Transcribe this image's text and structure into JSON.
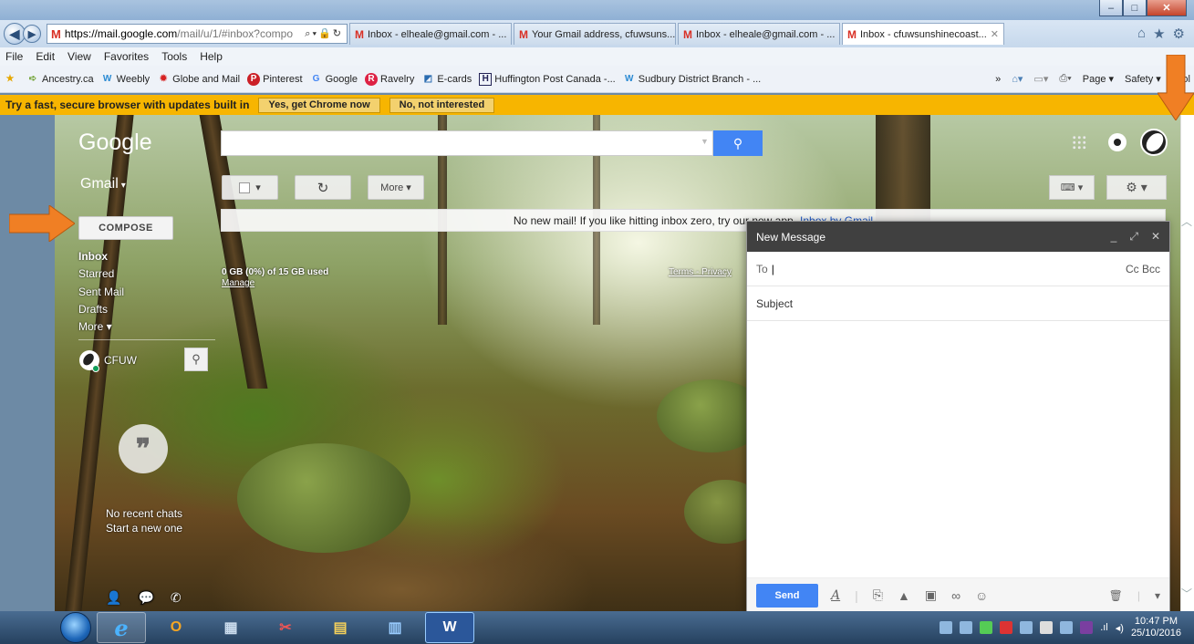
{
  "browser": {
    "url_host": "https://mail.google.com",
    "url_path": "/mail/u/1/#inbox?compo",
    "tabs": [
      {
        "label": "Inbox - elheale@gmail.com - ..."
      },
      {
        "label": "Your Gmail address, cfuwsuns..."
      },
      {
        "label": "Inbox - elheale@gmail.com - ..."
      },
      {
        "label": "Inbox - cfuwsunshinecoast..."
      }
    ],
    "menu": [
      "File",
      "Edit",
      "View",
      "Favorites",
      "Tools",
      "Help"
    ],
    "favorites": [
      "Ancestry.ca",
      "Weebly",
      "Globe and Mail",
      "Pinterest",
      "Google",
      "Ravelry",
      "E-cards",
      "Huffington Post Canada -...",
      "Sudbury District Branch - ..."
    ],
    "command_bar": [
      "Page ▾",
      "Safety ▾",
      "Tool"
    ],
    "chrome_prompt": "Try a fast, secure browser with updates built in",
    "chrome_yes": "Yes, get Chrome now",
    "chrome_no": "No, not interested"
  },
  "gmail": {
    "logo": "Google",
    "product": "Gmail",
    "compose": "COMPOSE",
    "more_btn": "More ▾",
    "notice_text": "No new mail! If you like hitting inbox zero, try our new app,",
    "notice_link": "Inbox by Gmail",
    "nav": {
      "inbox": "Inbox",
      "starred": "Starred",
      "sent": "Sent Mail",
      "drafts": "Drafts",
      "more": "More ▾"
    },
    "storage": "0 GB (0%) of 15 GB used",
    "manage": "Manage",
    "terms": "Terms - Privacy",
    "hangouts_name": "CFUW",
    "no_chats": "No recent chats",
    "start_new": "Start a new one"
  },
  "compose_window": {
    "title": "New Message",
    "to_label": "To",
    "cc_bcc": "Cc Bcc",
    "subject_label": "Subject",
    "send": "Send"
  },
  "taskbar": {
    "time": "10:47 PM",
    "date": "25/10/2016"
  }
}
